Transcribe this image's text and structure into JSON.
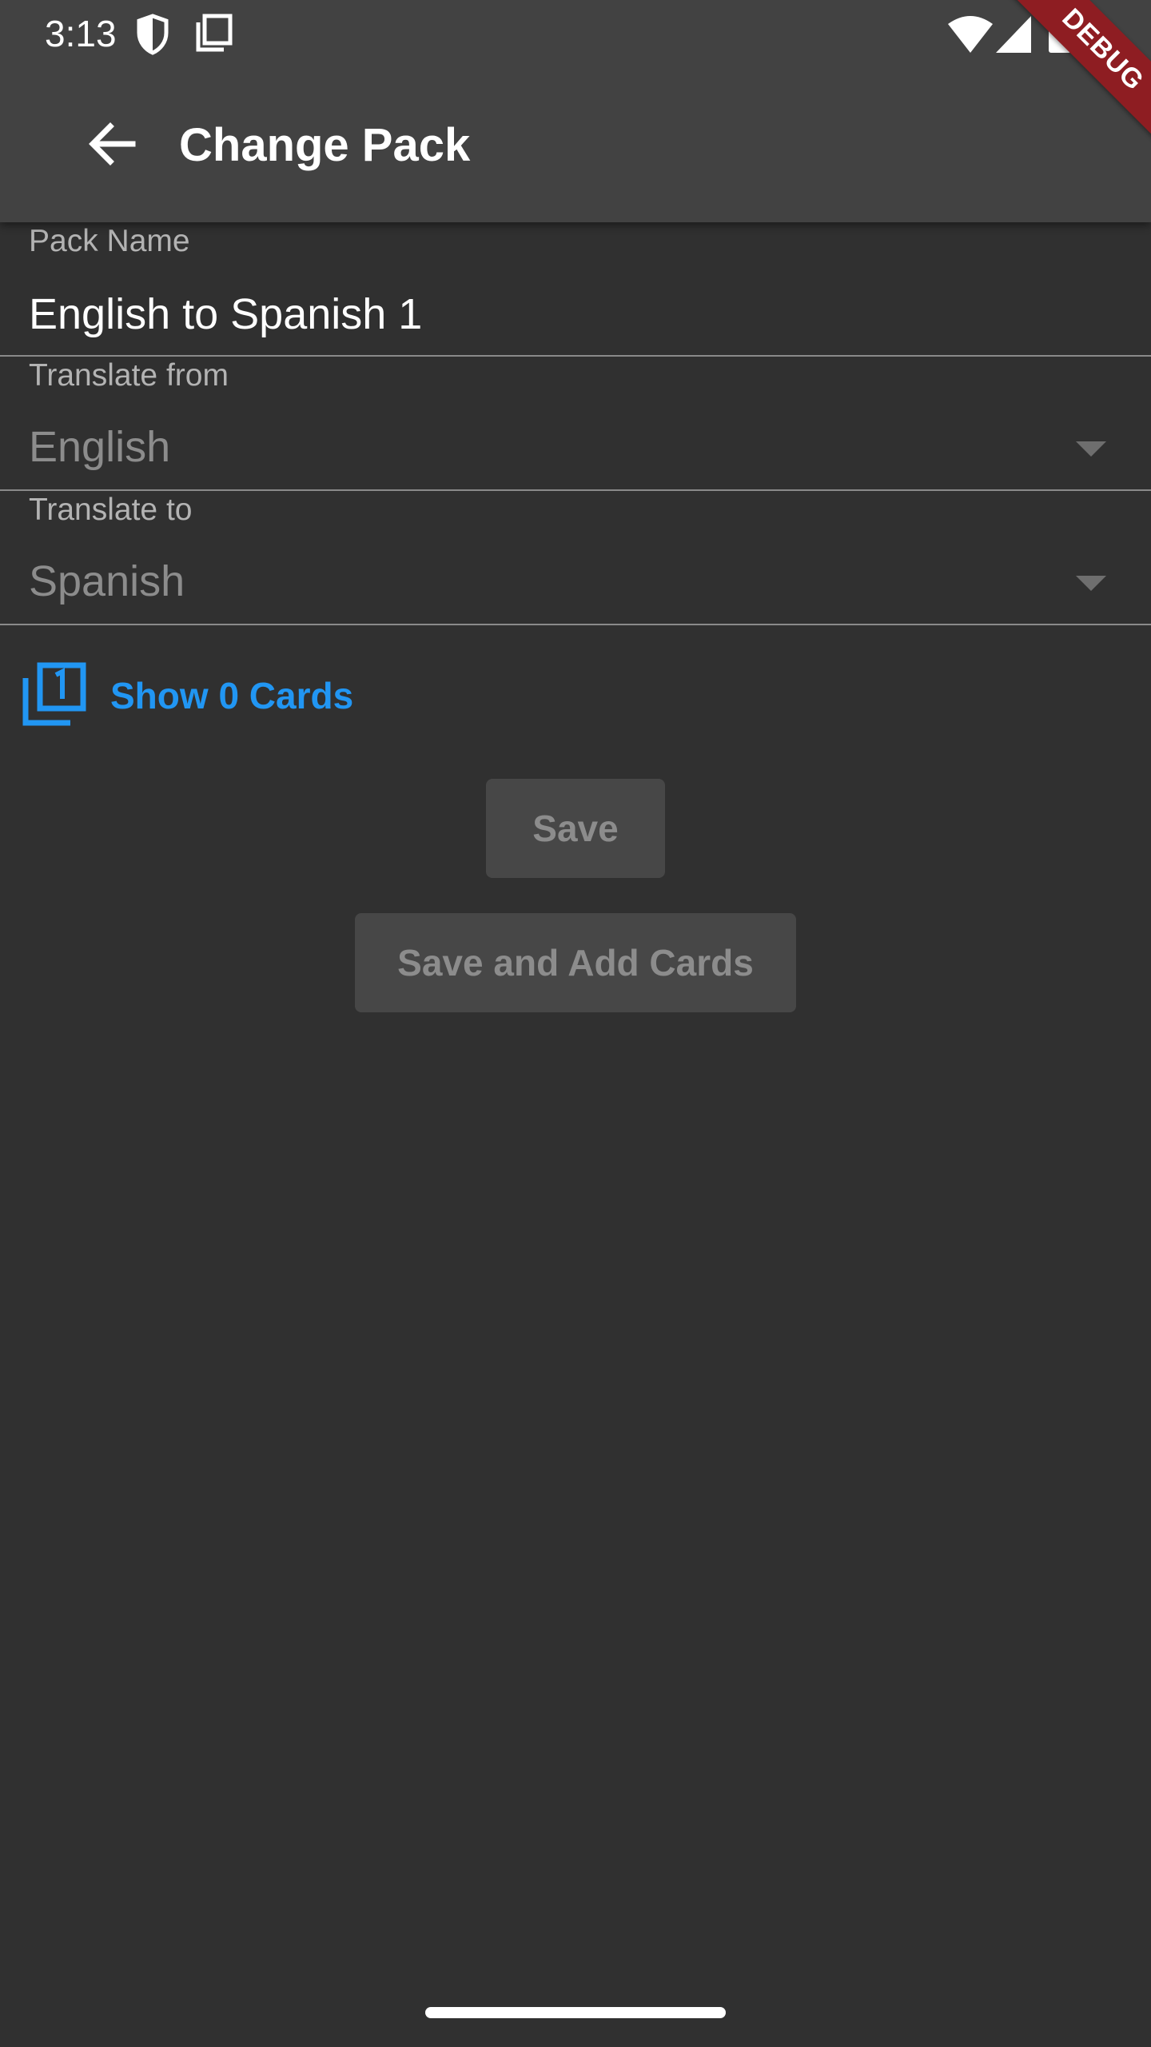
{
  "status_bar": {
    "time": "3:13",
    "icons": [
      "shield-icon",
      "notification-card-icon",
      "wifi-icon",
      "signal-icon",
      "battery-icon"
    ]
  },
  "app_bar": {
    "title": "Change Pack",
    "back_icon": "arrow-back-icon"
  },
  "debug_banner": "DEBUG",
  "form": {
    "pack_name": {
      "label": "Pack Name",
      "value": "English to Spanish 1"
    },
    "translate_from": {
      "label": "Translate from",
      "value": "English"
    },
    "translate_to": {
      "label": "Translate to",
      "value": "Spanish"
    }
  },
  "show_cards": {
    "icon": "filter-1-icon",
    "label": "Show 0 Cards"
  },
  "buttons": {
    "save": "Save",
    "save_and_add": "Save and Add Cards"
  },
  "colors": {
    "background": "#303030",
    "app_bar": "#424242",
    "accent": "#2196f3",
    "debug": "#8e1d22",
    "disabled_button": "#474747"
  }
}
